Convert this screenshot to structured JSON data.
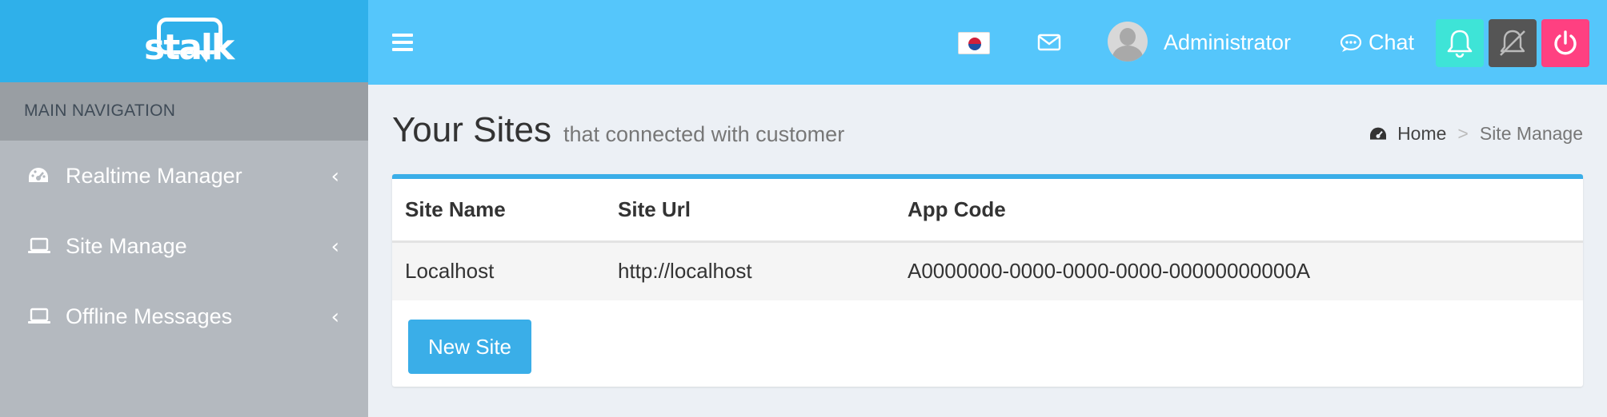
{
  "brand": {
    "logo_text": "stalk"
  },
  "sidebar": {
    "header": "MAIN NAVIGATION",
    "items": [
      {
        "label": "Realtime Manager",
        "icon": "dashboard-icon"
      },
      {
        "label": "Site Manage",
        "icon": "laptop-icon"
      },
      {
        "label": "Offline Messages",
        "icon": "laptop-icon"
      }
    ]
  },
  "topbar": {
    "user_name": "Administrator",
    "chat_label": "Chat",
    "language_flag": "korea-flag-icon"
  },
  "page": {
    "title": "Your Sites",
    "subtitle": "that connected with customer"
  },
  "breadcrumb": {
    "home": "Home",
    "separator": ">",
    "current": "Site Manage"
  },
  "table": {
    "headers": [
      "Site Name",
      "Site Url",
      "App Code"
    ],
    "rows": [
      [
        "Localhost",
        "http://localhost",
        "A0000000-0000-0000-0000-00000000000A"
      ]
    ]
  },
  "actions": {
    "new_site": "New Site"
  },
  "colors": {
    "sidebar_logo": "#2fb0ea",
    "topbar": "#55c6fb",
    "accent": "#3aaee8",
    "bell": "#3ee4d7",
    "mute": "#555555",
    "power": "#ff4081"
  }
}
